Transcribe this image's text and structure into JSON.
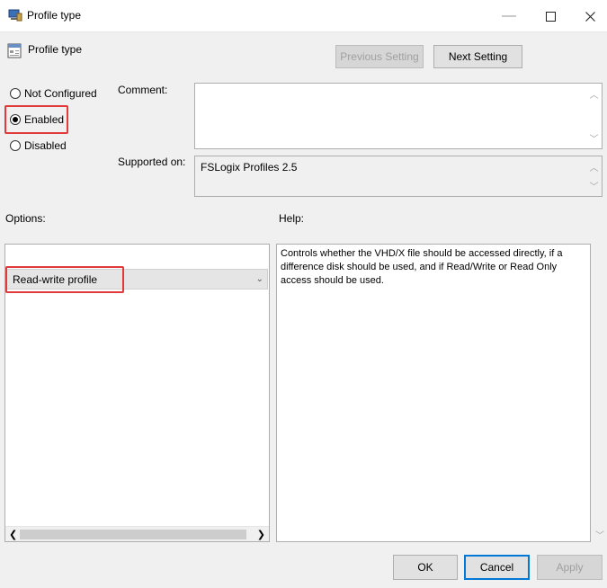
{
  "window": {
    "title": "Profile type",
    "minimize_glyph": "—",
    "maximize_glyph": "☐",
    "close_glyph": "✕"
  },
  "header": {
    "setting_title": "Profile type",
    "previous_setting": "Previous Setting",
    "next_setting": "Next Setting"
  },
  "state": {
    "options": [
      "Not Configured",
      "Enabled",
      "Disabled"
    ],
    "selected": "Enabled"
  },
  "labels": {
    "comment": "Comment:",
    "supported_on": "Supported on:",
    "options": "Options:",
    "help": "Help:"
  },
  "fields": {
    "comment_value": "",
    "supported_on_value": "FSLogix Profiles 2.5"
  },
  "options_panel": {
    "dropdown_value": "Read-write profile"
  },
  "help_panel": {
    "text": "Controls whether the VHD/X file should be accessed directly, if a difference disk should be used, and if Read/Write or Read Only access should be used."
  },
  "footer": {
    "ok": "OK",
    "cancel": "Cancel",
    "apply": "Apply"
  },
  "colors": {
    "highlight": "#e03a3a",
    "focus": "#0078d7"
  },
  "icons": [
    "gpo-app-icon",
    "policy-setting-icon",
    "minimize-icon",
    "maximize-icon",
    "close-icon",
    "chevron-down-icon",
    "scroll-up-icon",
    "scroll-down-icon",
    "scroll-left-icon",
    "scroll-right-icon"
  ]
}
